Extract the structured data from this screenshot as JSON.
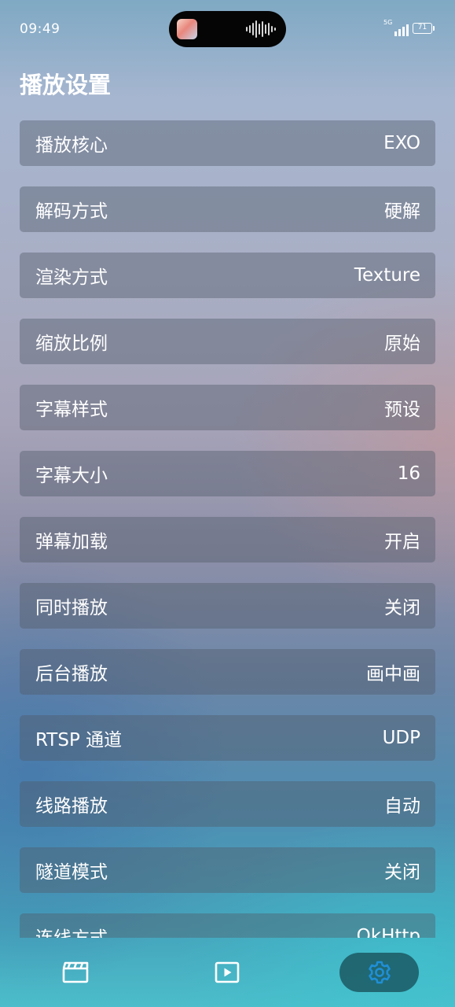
{
  "status_bar": {
    "time": "09:49",
    "network": "5G",
    "battery": "71"
  },
  "page": {
    "title": "播放设置"
  },
  "settings": [
    {
      "label": "播放核心",
      "value": "EXO"
    },
    {
      "label": "解码方式",
      "value": "硬解"
    },
    {
      "label": "渲染方式",
      "value": "Texture"
    },
    {
      "label": "缩放比例",
      "value": "原始"
    },
    {
      "label": "字幕样式",
      "value": "预设"
    },
    {
      "label": "字幕大小",
      "value": "16"
    },
    {
      "label": "弹幕加载",
      "value": "开启"
    },
    {
      "label": "同时播放",
      "value": "关闭"
    },
    {
      "label": "后台播放",
      "value": "画中画"
    },
    {
      "label": "RTSP 通道",
      "value": "UDP"
    },
    {
      "label": "线路播放",
      "value": "自动"
    },
    {
      "label": "隧道模式",
      "value": "关闭"
    },
    {
      "label": "连线方式",
      "value": "OkHttp"
    }
  ],
  "nav": {
    "items": [
      {
        "icon": "clapperboard-icon"
      },
      {
        "icon": "play-icon"
      },
      {
        "icon": "gear-icon"
      }
    ],
    "active_color": "#1f8fd6"
  }
}
